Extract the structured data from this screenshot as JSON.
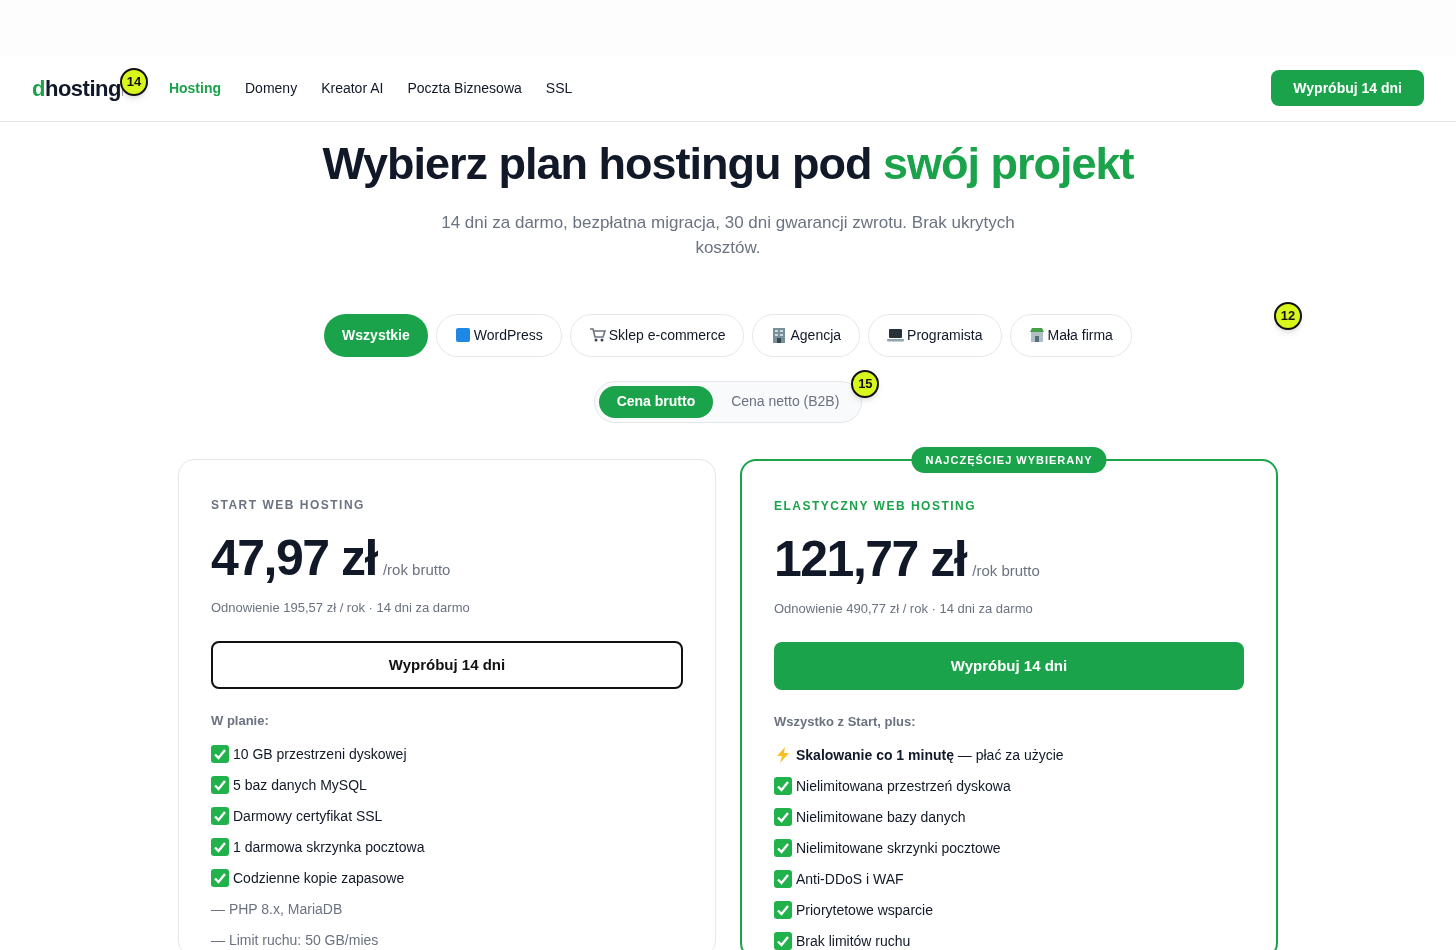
{
  "nav": {
    "logo": {
      "accent": "d",
      "rest": "hosting"
    },
    "links": [
      {
        "label": "Hosting",
        "selected": true
      },
      {
        "label": "Domeny",
        "selected": false
      },
      {
        "label": "Kreator AI",
        "selected": false
      },
      {
        "label": "Poczta Biznesowa",
        "selected": false
      },
      {
        "label": "SSL",
        "selected": false
      }
    ],
    "cta": "Wypróbuj 14 dni"
  },
  "hero": {
    "title": "Wybierz plan hostingu pod",
    "title_accent": "swój projekt",
    "subtitle": "14 dni za darmo, bezpłatna migracja, 30 dni gwarancji zwrotu. Brak ukrytych kosztów."
  },
  "filters": [
    {
      "label": "Wszystkie",
      "selected": true
    },
    {
      "label": "WordPress",
      "selected": false
    },
    {
      "label": "Sklep e-commerce",
      "selected": false
    },
    {
      "label": "Agencja",
      "selected": false
    },
    {
      "label": "Programista",
      "selected": false
    },
    {
      "label": "Mała firma",
      "selected": false
    }
  ],
  "price_toggle": [
    {
      "label": "Cena brutto",
      "selected": true
    },
    {
      "label": "Cena netto (B2B)",
      "selected": false
    }
  ],
  "plans": [
    {
      "name": "START WEB HOSTING",
      "featured": false,
      "price": "47,97 zł",
      "period": "/rok brutto",
      "renewal": "Odnowienie 195,57 zł / rok · 14 dni za darmo",
      "button": "Wypróbuj 14 dni",
      "intro": "W planie:",
      "features": [
        {
          "kind": "check",
          "text": "10 GB przestrzeni dyskowej"
        },
        {
          "kind": "check",
          "text": "5 baz danych MySQL"
        },
        {
          "kind": "check",
          "text": "Darmowy certyfikat SSL"
        },
        {
          "kind": "check",
          "text": "1 darmowa skrzynka pocztowa"
        },
        {
          "kind": "check",
          "text": "Codzienne kopie zapasowe"
        },
        {
          "kind": "dash",
          "text": "— PHP 8.x, MariaDB"
        },
        {
          "kind": "dash",
          "text": "— Limit ruchu: 50 GB/mies"
        }
      ]
    },
    {
      "name": "ELASTYCZNY WEB HOSTING",
      "featured": true,
      "badge": "NAJCZĘŚCIEJ WYBIERANY",
      "price": "121,77 zł",
      "period": "/rok brutto",
      "renewal": "Odnowienie 490,77 zł / rok · 14 dni za darmo",
      "button": "Wypróbuj 14 dni",
      "intro": "Wszystko z Start, plus:",
      "features": [
        {
          "kind": "bolt",
          "text": "**Skalowanie co 1 minutę** — płać za użycie"
        },
        {
          "kind": "check",
          "text": "Nielimitowana przestrzeń dyskowa"
        },
        {
          "kind": "check",
          "text": "Nielimitowane bazy danych"
        },
        {
          "kind": "check",
          "text": "Nielimitowane skrzynki pocztowe"
        },
        {
          "kind": "check",
          "text": "Anti-DDoS i WAF"
        },
        {
          "kind": "check",
          "text": "Priorytetowe wsparcie"
        },
        {
          "kind": "check",
          "text": "Brak limitów ruchu"
        }
      ]
    }
  ],
  "markers": [
    {
      "label": "14"
    },
    {
      "label": "12"
    },
    {
      "label": "15"
    }
  ]
}
